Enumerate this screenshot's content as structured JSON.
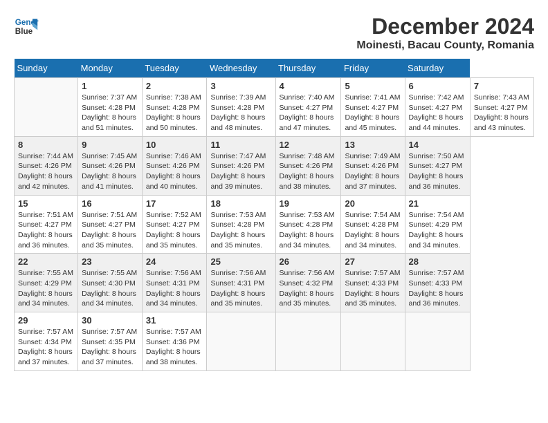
{
  "header": {
    "logo_line1": "General",
    "logo_line2": "Blue",
    "title": "December 2024",
    "subtitle": "Moinesti, Bacau County, Romania"
  },
  "calendar": {
    "days_of_week": [
      "Sunday",
      "Monday",
      "Tuesday",
      "Wednesday",
      "Thursday",
      "Friday",
      "Saturday"
    ],
    "weeks": [
      [
        {
          "day": "",
          "info": ""
        },
        {
          "day": "1",
          "info": "Sunrise: 7:37 AM\nSunset: 4:28 PM\nDaylight: 8 hours\nand 51 minutes."
        },
        {
          "day": "2",
          "info": "Sunrise: 7:38 AM\nSunset: 4:28 PM\nDaylight: 8 hours\nand 50 minutes."
        },
        {
          "day": "3",
          "info": "Sunrise: 7:39 AM\nSunset: 4:28 PM\nDaylight: 8 hours\nand 48 minutes."
        },
        {
          "day": "4",
          "info": "Sunrise: 7:40 AM\nSunset: 4:27 PM\nDaylight: 8 hours\nand 47 minutes."
        },
        {
          "day": "5",
          "info": "Sunrise: 7:41 AM\nSunset: 4:27 PM\nDaylight: 8 hours\nand 45 minutes."
        },
        {
          "day": "6",
          "info": "Sunrise: 7:42 AM\nSunset: 4:27 PM\nDaylight: 8 hours\nand 44 minutes."
        },
        {
          "day": "7",
          "info": "Sunrise: 7:43 AM\nSunset: 4:27 PM\nDaylight: 8 hours\nand 43 minutes."
        }
      ],
      [
        {
          "day": "8",
          "info": "Sunrise: 7:44 AM\nSunset: 4:26 PM\nDaylight: 8 hours\nand 42 minutes."
        },
        {
          "day": "9",
          "info": "Sunrise: 7:45 AM\nSunset: 4:26 PM\nDaylight: 8 hours\nand 41 minutes."
        },
        {
          "day": "10",
          "info": "Sunrise: 7:46 AM\nSunset: 4:26 PM\nDaylight: 8 hours\nand 40 minutes."
        },
        {
          "day": "11",
          "info": "Sunrise: 7:47 AM\nSunset: 4:26 PM\nDaylight: 8 hours\nand 39 minutes."
        },
        {
          "day": "12",
          "info": "Sunrise: 7:48 AM\nSunset: 4:26 PM\nDaylight: 8 hours\nand 38 minutes."
        },
        {
          "day": "13",
          "info": "Sunrise: 7:49 AM\nSunset: 4:26 PM\nDaylight: 8 hours\nand 37 minutes."
        },
        {
          "day": "14",
          "info": "Sunrise: 7:50 AM\nSunset: 4:27 PM\nDaylight: 8 hours\nand 36 minutes."
        }
      ],
      [
        {
          "day": "15",
          "info": "Sunrise: 7:51 AM\nSunset: 4:27 PM\nDaylight: 8 hours\nand 36 minutes."
        },
        {
          "day": "16",
          "info": "Sunrise: 7:51 AM\nSunset: 4:27 PM\nDaylight: 8 hours\nand 35 minutes."
        },
        {
          "day": "17",
          "info": "Sunrise: 7:52 AM\nSunset: 4:27 PM\nDaylight: 8 hours\nand 35 minutes."
        },
        {
          "day": "18",
          "info": "Sunrise: 7:53 AM\nSunset: 4:28 PM\nDaylight: 8 hours\nand 35 minutes."
        },
        {
          "day": "19",
          "info": "Sunrise: 7:53 AM\nSunset: 4:28 PM\nDaylight: 8 hours\nand 34 minutes."
        },
        {
          "day": "20",
          "info": "Sunrise: 7:54 AM\nSunset: 4:28 PM\nDaylight: 8 hours\nand 34 minutes."
        },
        {
          "day": "21",
          "info": "Sunrise: 7:54 AM\nSunset: 4:29 PM\nDaylight: 8 hours\nand 34 minutes."
        }
      ],
      [
        {
          "day": "22",
          "info": "Sunrise: 7:55 AM\nSunset: 4:29 PM\nDaylight: 8 hours\nand 34 minutes."
        },
        {
          "day": "23",
          "info": "Sunrise: 7:55 AM\nSunset: 4:30 PM\nDaylight: 8 hours\nand 34 minutes."
        },
        {
          "day": "24",
          "info": "Sunrise: 7:56 AM\nSunset: 4:31 PM\nDaylight: 8 hours\nand 34 minutes."
        },
        {
          "day": "25",
          "info": "Sunrise: 7:56 AM\nSunset: 4:31 PM\nDaylight: 8 hours\nand 35 minutes."
        },
        {
          "day": "26",
          "info": "Sunrise: 7:56 AM\nSunset: 4:32 PM\nDaylight: 8 hours\nand 35 minutes."
        },
        {
          "day": "27",
          "info": "Sunrise: 7:57 AM\nSunset: 4:33 PM\nDaylight: 8 hours\nand 35 minutes."
        },
        {
          "day": "28",
          "info": "Sunrise: 7:57 AM\nSunset: 4:33 PM\nDaylight: 8 hours\nand 36 minutes."
        }
      ],
      [
        {
          "day": "29",
          "info": "Sunrise: 7:57 AM\nSunset: 4:34 PM\nDaylight: 8 hours\nand 37 minutes."
        },
        {
          "day": "30",
          "info": "Sunrise: 7:57 AM\nSunset: 4:35 PM\nDaylight: 8 hours\nand 37 minutes."
        },
        {
          "day": "31",
          "info": "Sunrise: 7:57 AM\nSunset: 4:36 PM\nDaylight: 8 hours\nand 38 minutes."
        },
        {
          "day": "",
          "info": ""
        },
        {
          "day": "",
          "info": ""
        },
        {
          "day": "",
          "info": ""
        },
        {
          "day": "",
          "info": ""
        }
      ]
    ]
  }
}
